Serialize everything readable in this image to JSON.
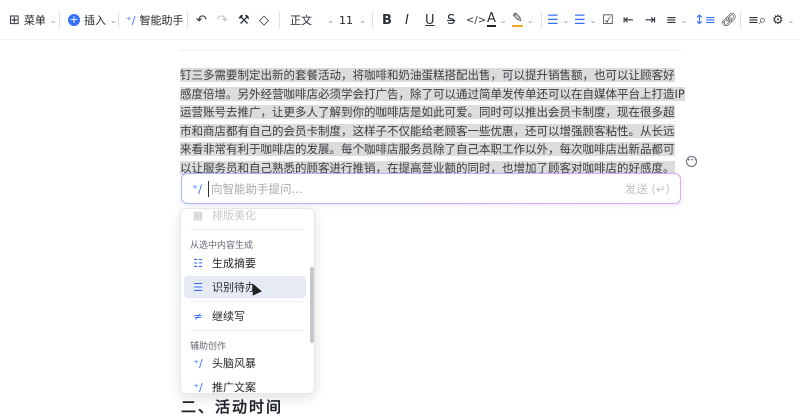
{
  "toolbar": {
    "menu": "菜单",
    "insert": "插入",
    "assistant": "智能助手",
    "style": "正文",
    "font_size": "11"
  },
  "document": {
    "paragraph": "钉三多需要制定出新的套餐活动，将咖啡和奶油蛋糕搭配出售，可以提升销售额，也可以让顾客好感度倍增。另外经营咖啡店必须学会打广告，除了可以通过简单发传单还可以在自媒体平台上打造IP运营账号去推广，让更多人了解到你的咖啡店是如此可爱。同时可以推出会员卡制度，现在很多超市和商店都有自己的会员卡制度，这样子不仅能给老顾客一些优惠，还可以增强顾客粘性。从长远来看非常有利于咖啡店的发展。每个咖啡店服务员除了自己本职工作以外，每次咖啡店出新品都可以让服务员和自己熟悉的顾客进行推销，在提高营业额的同时，也增加了顾客对咖啡店的好感度。",
    "next_heading": "二、活动时间"
  },
  "assistant_input": {
    "placeholder": "向智能助手提问...",
    "send": "发送 (↵)"
  },
  "menu": {
    "top_item": "排版美化",
    "group1": "从选中内容生成",
    "summary": "生成摘要",
    "todo": "识别待办",
    "continue": "继续写",
    "group2": "辅助创作",
    "brainstorm": "头脑风暴",
    "promo": "推广文案"
  },
  "colors": {
    "accent": "#3370ff",
    "selection": "#dcdcdc"
  }
}
